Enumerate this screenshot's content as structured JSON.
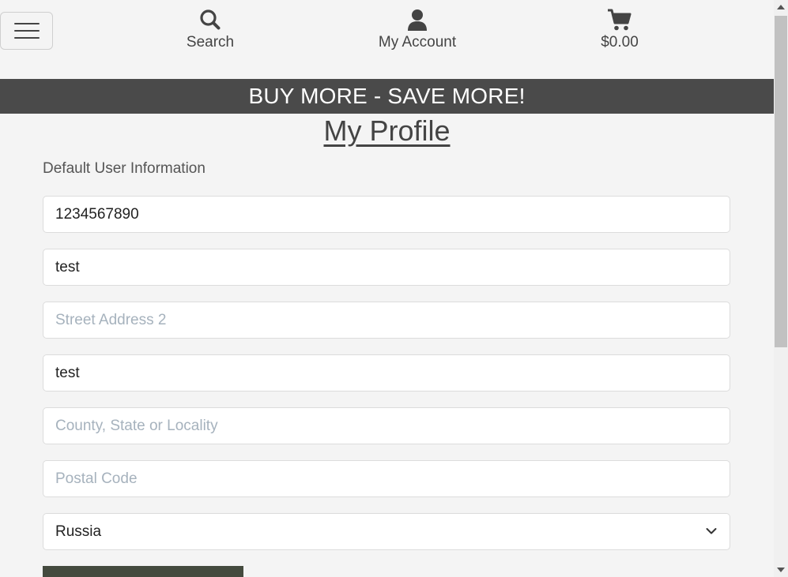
{
  "header": {
    "nav": {
      "search_label": "Search",
      "account_label": "My Account",
      "cart_label": "$0.00"
    }
  },
  "promo": {
    "text": "BUY MORE - SAVE MORE!"
  },
  "profile": {
    "title": "My Profile",
    "section_label": "Default User Information",
    "fields": {
      "phone": {
        "value": "1234567890",
        "placeholder": ""
      },
      "street1": {
        "value": "test",
        "placeholder": ""
      },
      "street2": {
        "value": "",
        "placeholder": "Street Address 2"
      },
      "city": {
        "value": "test",
        "placeholder": ""
      },
      "state": {
        "value": "",
        "placeholder": "County, State or Locality"
      },
      "postal": {
        "value": "",
        "placeholder": "Postal Code"
      }
    },
    "country": {
      "selected": "Russia"
    }
  },
  "colors": {
    "promo_bg": "#4a4a4a",
    "button_bg": "#444a3e",
    "placeholder": "#a6b2bd"
  },
  "icons": {
    "menu": "hamburger-icon",
    "search": "magnifier-icon",
    "account": "user-icon",
    "cart": "cart-icon",
    "select": "chevron-down-icon"
  }
}
